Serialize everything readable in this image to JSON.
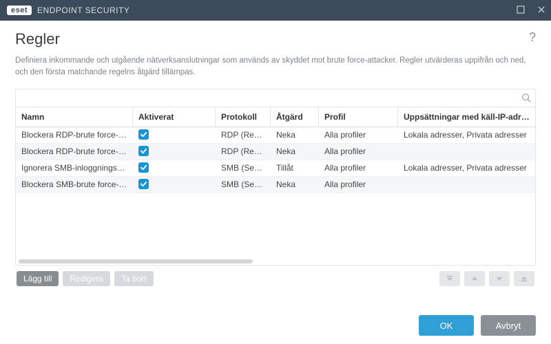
{
  "brand": "eset",
  "app_name": "ENDPOINT SECURITY",
  "page_title": "Regler",
  "help_tooltip": "?",
  "description": "Definiera inkommande och utgående nätverksanslutningar som används av skyddet mot brute force-attacker. Regler utvärderas uppifrån och ned, och den första matchande regelns åtgärd tillämpas.",
  "search_placeholder": "",
  "columns": {
    "name": "Namn",
    "enabled": "Aktiverat",
    "protocol": "Protokoll",
    "action": "Åtgärd",
    "profile": "Profil",
    "source_ip": "Uppsättningar med käll-IP-adresser"
  },
  "rows": [
    {
      "name": "Blockera RDP-brute force-at…",
      "enabled": true,
      "protocol": "RDP (Remo…",
      "action": "Neka",
      "profile": "Alla profiler",
      "source_ip": "Lokala adresser, Privata adresser"
    },
    {
      "name": "Blockera RDP-brute force-at…",
      "enabled": true,
      "protocol": "RDP (Remo…",
      "action": "Neka",
      "profile": "Alla profiler",
      "source_ip": ""
    },
    {
      "name": "Ignorera SMB-inloggningsför…",
      "enabled": true,
      "protocol": "SMB (Server …",
      "action": "Tillåt",
      "profile": "Alla profiler",
      "source_ip": "Lokala adresser, Privata adresser"
    },
    {
      "name": "Blockera SMB-brute force-at…",
      "enabled": true,
      "protocol": "SMB (Server …",
      "action": "Neka",
      "profile": "Alla profiler",
      "source_ip": ""
    }
  ],
  "toolbar": {
    "add": "Lägg till",
    "edit": "Redigera",
    "delete": "Ta bort"
  },
  "footer": {
    "ok": "OK",
    "cancel": "Avbryt"
  }
}
